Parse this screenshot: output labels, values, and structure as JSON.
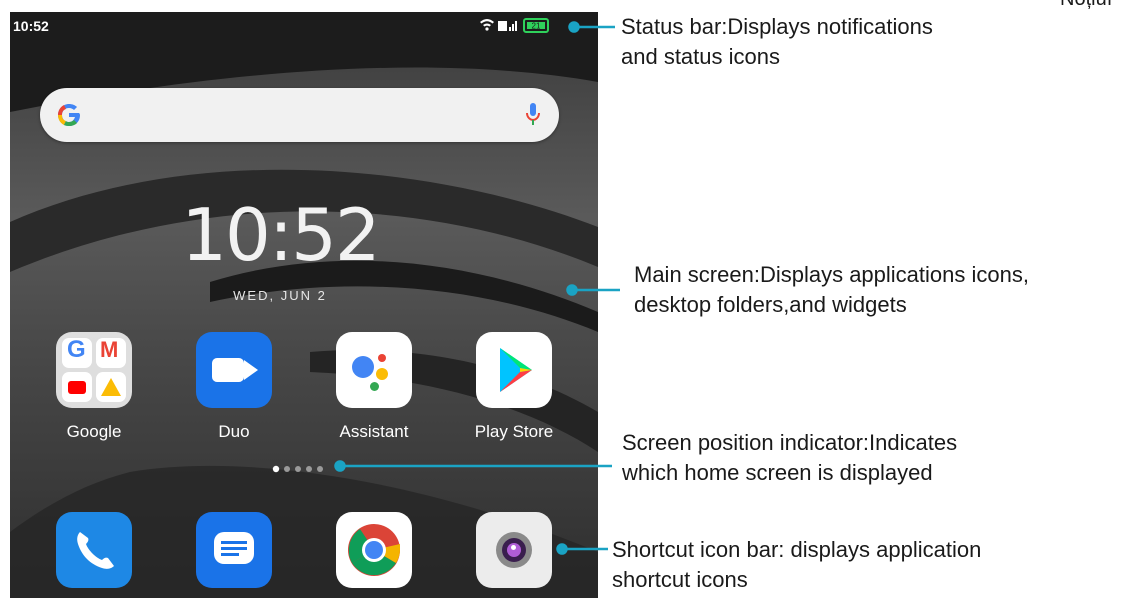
{
  "corner_label": "Noțiuı",
  "phone": {
    "status_time": "10:52",
    "battery": "21",
    "clock": "10:52",
    "date": "WED, JUN 2",
    "apps": [
      {
        "label": "Google"
      },
      {
        "label": "Duo"
      },
      {
        "label": "Assistant"
      },
      {
        "label": "Play Store"
      }
    ],
    "dock": [
      {
        "icon": "phone-icon"
      },
      {
        "icon": "messages-icon"
      },
      {
        "icon": "chrome-icon"
      },
      {
        "icon": "camera-icon"
      }
    ],
    "page_count": 5,
    "active_page": 1
  },
  "annotations": {
    "status_bar": {
      "line1": "Status  bar:Displays  notifications",
      "line2": "and status icons"
    },
    "main_screen": {
      "line1": "Main screen:Displays applications icons,",
      "line2": "desktop folders,and widgets"
    },
    "position_indicator": {
      "line1": "Screen  position  indicator:Indicates",
      "line2": "which home screen is displayed"
    },
    "shortcut_bar": {
      "line1": "Shortcut icon bar: displays application",
      "line2": "shortcut icons"
    }
  },
  "colors": {
    "leader_line": "#1aa3c4",
    "label_text": "#1a1a1a"
  }
}
